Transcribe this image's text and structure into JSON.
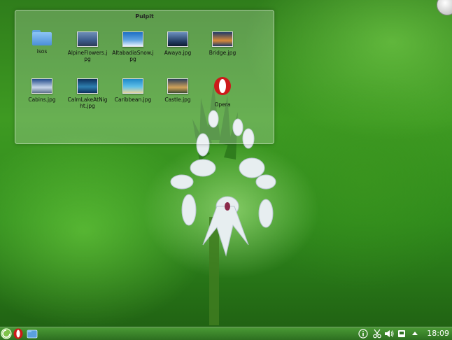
{
  "desktop": {
    "folderview": {
      "title": "Pulpit",
      "items": [
        {
          "label": "isos",
          "type": "folder",
          "icon": "folder-icon"
        },
        {
          "label": "AlpineFlowers.jpg",
          "type": "image",
          "icon": "image-thumbnail-icon",
          "colors": [
            "#3c5b8a",
            "#6f8fb8"
          ]
        },
        {
          "label": "AltabadiaSnow.jpg",
          "type": "image",
          "icon": "image-thumbnail-icon",
          "colors": [
            "#1d6fc4",
            "#e8f2ff"
          ]
        },
        {
          "label": "Awaya.jpg",
          "type": "image",
          "icon": "image-thumbnail-icon",
          "colors": [
            "#20395e",
            "#6c90bf"
          ]
        },
        {
          "label": "Bridge.jpg",
          "type": "image",
          "icon": "image-thumbnail-icon",
          "colors": [
            "#213a66",
            "#d98a3a"
          ]
        },
        {
          "label": "Cabins.jpg",
          "type": "image",
          "icon": "image-thumbnail-icon",
          "colors": [
            "#234c8c",
            "#c9d7ea"
          ]
        },
        {
          "label": "CalmLakeAtNight.jpg",
          "type": "image",
          "icon": "image-thumbnail-icon",
          "colors": [
            "#0d2f5a",
            "#2e7fb0"
          ]
        },
        {
          "label": "Caribbean.jpg",
          "type": "image",
          "icon": "image-thumbnail-icon",
          "colors": [
            "#1e88c9",
            "#e6d59d"
          ]
        },
        {
          "label": "Castle.jpg",
          "type": "image",
          "icon": "image-thumbnail-icon",
          "colors": [
            "#2c3e5a",
            "#d2a35a"
          ]
        },
        {
          "label": "Opera",
          "type": "app",
          "icon": "opera-icon"
        }
      ]
    }
  },
  "panel": {
    "left_items": [
      {
        "name": "kickoff-launcher-icon"
      },
      {
        "name": "opera-icon"
      },
      {
        "name": "dolphin-file-manager-icon"
      }
    ],
    "tray": [
      {
        "name": "info-icon"
      },
      {
        "name": "klipper-scissors-icon"
      },
      {
        "name": "volume-icon"
      },
      {
        "name": "device-notifier-icon"
      },
      {
        "name": "tray-expand-arrow-icon"
      }
    ],
    "clock": "18:09"
  },
  "colors": {
    "panel": "#3d8a2c",
    "wallpaper": "#3e9a22",
    "opera_red": "#cc1a1a"
  }
}
